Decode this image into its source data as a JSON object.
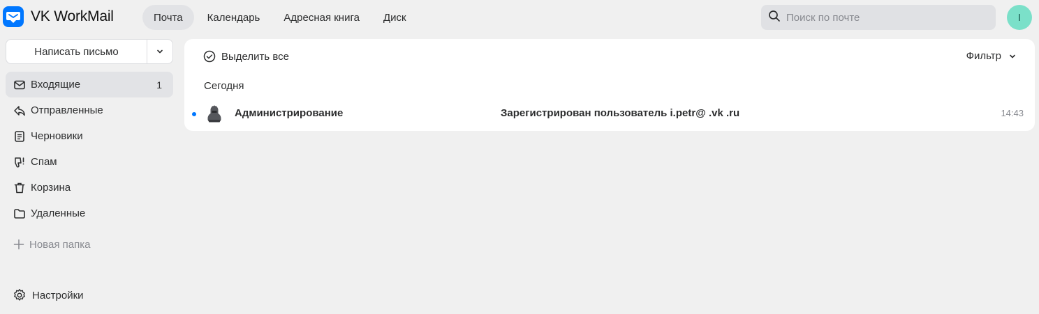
{
  "app": {
    "name": "VK WorkMail",
    "avatar_letter": "I"
  },
  "nav": {
    "tabs": [
      {
        "label": "Почта",
        "active": true
      },
      {
        "label": "Календарь",
        "active": false
      },
      {
        "label": "Адресная книга",
        "active": false
      },
      {
        "label": "Диск",
        "active": false
      }
    ]
  },
  "search": {
    "placeholder": "Поиск по почте",
    "icon": "search-icon"
  },
  "sidebar": {
    "compose_label": "Написать письмо",
    "folders": [
      {
        "label": "Входящие",
        "icon": "inbox-icon",
        "count": "1",
        "active": true
      },
      {
        "label": "Отправленные",
        "icon": "sent-icon",
        "count": "",
        "active": false
      },
      {
        "label": "Черновики",
        "icon": "drafts-icon",
        "count": "",
        "active": false
      },
      {
        "label": "Спам",
        "icon": "spam-icon",
        "count": "",
        "active": false
      },
      {
        "label": "Корзина",
        "icon": "trash-icon",
        "count": "",
        "active": false
      },
      {
        "label": "Удаленные",
        "icon": "folder-icon",
        "count": "",
        "active": false
      }
    ],
    "new_folder_label": "Новая папка",
    "settings_label": "Настройки"
  },
  "toolbar": {
    "select_all_label": "Выделить все",
    "filter_label": "Фильтр"
  },
  "mail_list": {
    "groups": [
      {
        "title": "Сегодня",
        "messages": [
          {
            "sender": "Администрирование",
            "subject": "Зарегистрирован пользователь i.petr@ .vk .ru",
            "time": "14:43",
            "unread": true
          }
        ]
      }
    ]
  },
  "colors": {
    "accent": "#0077ff",
    "background": "#f0f0f0",
    "panel": "#ffffff",
    "avatar": "#7be0c9"
  }
}
